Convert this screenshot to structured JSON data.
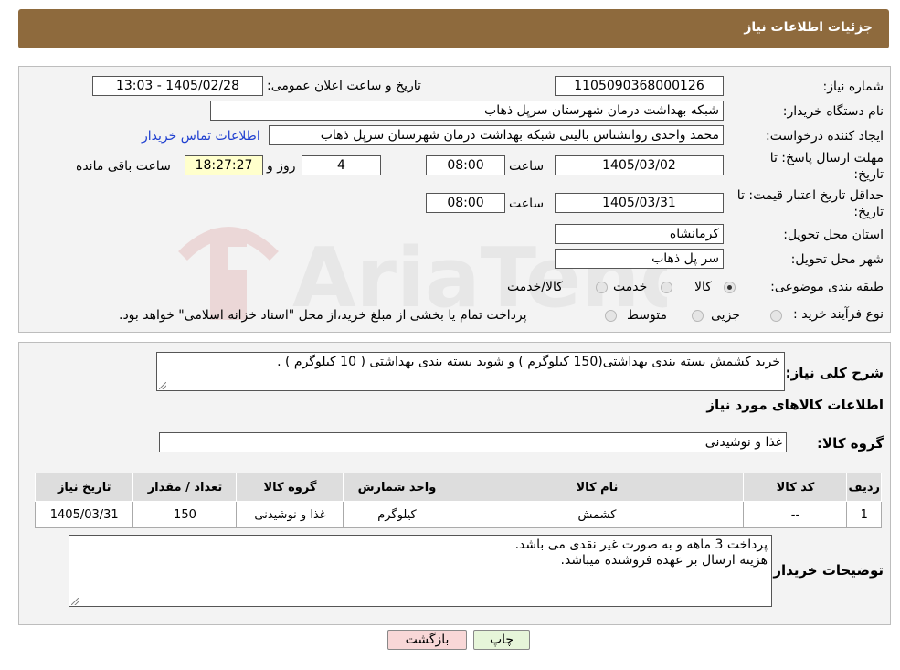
{
  "header": {
    "title": "جزئيات اطلاعات نياز"
  },
  "form": {
    "need_number_label": "شماره نیاز:",
    "need_number": "1105090368000126",
    "announce_label": "تاریخ و ساعت اعلان عمومی:",
    "announce_value": "1405/02/28 - 13:03",
    "buyer_org_label": "نام دستگاه خریدار:",
    "buyer_org": "شبکه بهداشت درمان شهرستان سرپل ذهاب",
    "requester_label": "ایجاد کننده درخواست:",
    "requester": "محمد واحدی روانشناس بالینی شبکه بهداشت درمان شهرستان سرپل ذهاب",
    "contact_link": "اطلاعات تماس خریدار",
    "deadline_label_1": "مهلت ارسال پاسخ: تا",
    "deadline_label_2": "تاریخ:",
    "deadline_date": "1405/03/02",
    "time_label": "ساعت",
    "deadline_time": "08:00",
    "days_value": "4",
    "days_label": "روز و",
    "remaining_time": "18:27:27",
    "remaining_label": "ساعت باقی مانده",
    "validity_label_1": "حداقل تاریخ اعتبار قیمت: تا",
    "validity_label_2": "تاریخ:",
    "validity_date": "1405/03/31",
    "validity_time": "08:00",
    "province_label": "استان محل تحویل:",
    "province": "کرمانشاه",
    "city_label": "شهر محل تحویل:",
    "city": "سر پل ذهاب",
    "category_label": "طبقه بندی موضوعی:",
    "category_options": [
      "کالا",
      "خدمت",
      "کالا/خدمت"
    ],
    "category_selected": "کالا",
    "process_label": "نوع فرآیند خرید :",
    "process_options": [
      "جزیی",
      "متوسط"
    ],
    "process_note": "پرداخت تمام یا بخشی از مبلغ خرید،از محل \"اسناد خزانه اسلامی\" خواهد بود."
  },
  "description": {
    "label": "شرح کلی نیاز:",
    "text": "خرید کشمش بسته بندی بهداشتی(150 کیلوگرم ) و شوید بسته بندی بهداشتی ( 10 کیلوگرم ) .",
    "goods_info_title": "اطلاعات کالاهای مورد نیاز",
    "goods_group_label": "گروه کالا:",
    "goods_group": "غذا و نوشیدنی"
  },
  "table": {
    "headers": [
      "ردیف",
      "کد کالا",
      "نام کالا",
      "واحد شمارش",
      "گروه کالا",
      "تعداد / مقدار",
      "تاریخ نیاز"
    ],
    "rows": [
      [
        "1",
        "--",
        "کشمش",
        "کیلوگرم",
        "غذا و نوشیدنی",
        "150",
        "1405/03/31"
      ]
    ]
  },
  "buyer_notes": {
    "label": "توضیحات خریدار:",
    "line1": "پرداخت 3 ماهه و به صورت غیر نقدی می باشد.",
    "line2": "هزینه ارسال بر عهده فروشنده میباشد."
  },
  "buttons": {
    "print": "چاپ",
    "back": "بازگشت"
  },
  "colors": {
    "header": "#8e6a3d",
    "highlight_yellow": "#ffffcc",
    "link": "#1f3fd0",
    "back_button": "#f8d7d7",
    "print_button": "#e6f5d9"
  }
}
